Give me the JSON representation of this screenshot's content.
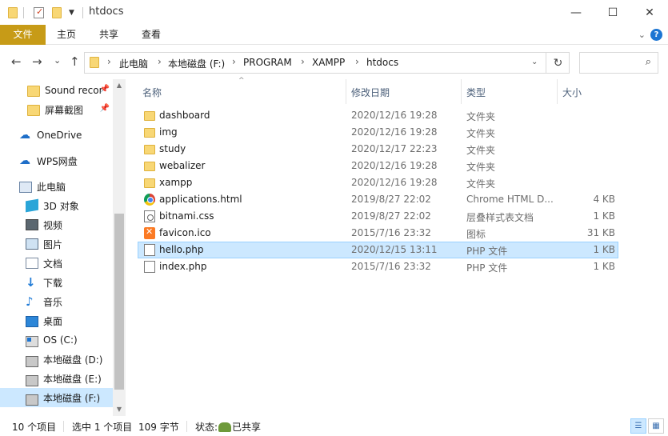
{
  "window": {
    "title": "htdocs",
    "minimize": "—",
    "maximize": "☐",
    "close": "✕"
  },
  "ribbon": {
    "tabs": [
      "文件",
      "主页",
      "共享",
      "查看"
    ],
    "expand_icon": "chevron-down-icon",
    "help": "?"
  },
  "nav": {
    "back": "←",
    "forward": "→",
    "recent": "⌄",
    "up": "↑",
    "breadcrumb": [
      "此电脑",
      "本地磁盘 (F:)",
      "PROGRAM",
      "XAMPP",
      "htdocs"
    ],
    "refresh": "↻",
    "search_placeholder": "",
    "search_icon": "⌕"
  },
  "sidebar": {
    "quick_access": [
      {
        "label": "Sound recor",
        "icon": "folder-icon",
        "pinned": true
      },
      {
        "label": "屏幕截图",
        "icon": "folder-icon",
        "pinned": true
      }
    ],
    "onedrive": "OneDrive",
    "wps": "WPS网盘",
    "this_pc": "此电脑",
    "pc_items": [
      {
        "label": "3D 对象",
        "icon": "3d-objects-icon"
      },
      {
        "label": "视频",
        "icon": "video-icon"
      },
      {
        "label": "图片",
        "icon": "pictures-icon"
      },
      {
        "label": "文档",
        "icon": "documents-icon"
      },
      {
        "label": "下载",
        "icon": "download-icon"
      },
      {
        "label": "音乐",
        "icon": "music-icon"
      },
      {
        "label": "桌面",
        "icon": "desktop-icon"
      },
      {
        "label": "OS (C:)",
        "icon": "os-drive-icon"
      },
      {
        "label": "本地磁盘 (D:)",
        "icon": "drive-icon"
      },
      {
        "label": "本地磁盘 (E:)",
        "icon": "drive-icon"
      },
      {
        "label": "本地磁盘 (F:)",
        "icon": "drive-icon",
        "selected": true
      }
    ]
  },
  "columns": {
    "name": "名称",
    "date": "修改日期",
    "type": "类型",
    "size": "大小"
  },
  "files": [
    {
      "name": "dashboard",
      "date": "2020/12/16 19:28",
      "type": "文件夹",
      "size": "",
      "icon": "folder-icon"
    },
    {
      "name": "img",
      "date": "2020/12/16 19:28",
      "type": "文件夹",
      "size": "",
      "icon": "folder-icon"
    },
    {
      "name": "study",
      "date": "2020/12/17 22:23",
      "type": "文件夹",
      "size": "",
      "icon": "folder-icon"
    },
    {
      "name": "webalizer",
      "date": "2020/12/16 19:28",
      "type": "文件夹",
      "size": "",
      "icon": "folder-icon"
    },
    {
      "name": "xampp",
      "date": "2020/12/16 19:28",
      "type": "文件夹",
      "size": "",
      "icon": "folder-icon"
    },
    {
      "name": "applications.html",
      "date": "2019/8/27 22:02",
      "type": "Chrome HTML D...",
      "size": "4 KB",
      "icon": "chrome-icon"
    },
    {
      "name": "bitnami.css",
      "date": "2019/8/27 22:02",
      "type": "层叠样式表文档",
      "size": "1 KB",
      "icon": "css-file-icon"
    },
    {
      "name": "favicon.ico",
      "date": "2015/7/16 23:32",
      "type": "图标",
      "size": "31 KB",
      "icon": "xampp-icon"
    },
    {
      "name": "hello.php",
      "date": "2020/12/15 13:11",
      "type": "PHP 文件",
      "size": "1 KB",
      "icon": "file-icon",
      "selected": true
    },
    {
      "name": "index.php",
      "date": "2015/7/16 23:32",
      "type": "PHP 文件",
      "size": "1 KB",
      "icon": "file-icon"
    }
  ],
  "status": {
    "count": "10 个项目",
    "selected": "选中 1 个项目",
    "bytes": "109 字节",
    "state_label": "状态:",
    "share": "已共享"
  }
}
